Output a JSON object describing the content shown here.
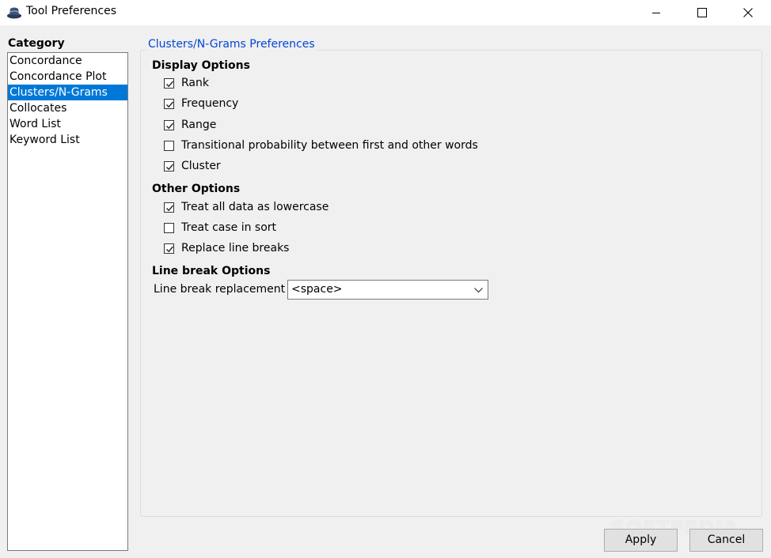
{
  "window": {
    "title": "Tool Preferences",
    "icon": "app-hat-icon",
    "controls": [
      "minimize-icon",
      "maximize-icon",
      "close-icon"
    ]
  },
  "category": {
    "label": "Category",
    "items": [
      {
        "label": "Concordance",
        "selected": false
      },
      {
        "label": "Concordance Plot",
        "selected": false
      },
      {
        "label": "Clusters/N-Grams",
        "selected": true
      },
      {
        "label": "Collocates",
        "selected": false
      },
      {
        "label": "Word List",
        "selected": false
      },
      {
        "label": "Keyword List",
        "selected": false
      }
    ]
  },
  "panel": {
    "title": "Clusters/N-Grams Preferences",
    "display_options": {
      "header": "Display Options",
      "items": [
        {
          "label": "Rank",
          "checked": true
        },
        {
          "label": "Frequency",
          "checked": true
        },
        {
          "label": "Range",
          "checked": true
        },
        {
          "label": "Transitional probability between first and other words",
          "checked": false
        },
        {
          "label": "Cluster",
          "checked": true
        }
      ]
    },
    "other_options": {
      "header": "Other Options",
      "items": [
        {
          "label": "Treat all data as lowercase",
          "checked": true
        },
        {
          "label": "Treat case in sort",
          "checked": false
        },
        {
          "label": "Replace line breaks",
          "checked": true
        }
      ]
    },
    "line_break_options": {
      "header": "Line break Options",
      "replacement_label": "Line break replacement",
      "replacement_value": "<space>"
    }
  },
  "buttons": {
    "apply": "Apply",
    "cancel": "Cancel"
  },
  "watermark": "SOFTPEDIA",
  "colors": {
    "selection": "#0078d7",
    "group_title": "#0046d5"
  }
}
